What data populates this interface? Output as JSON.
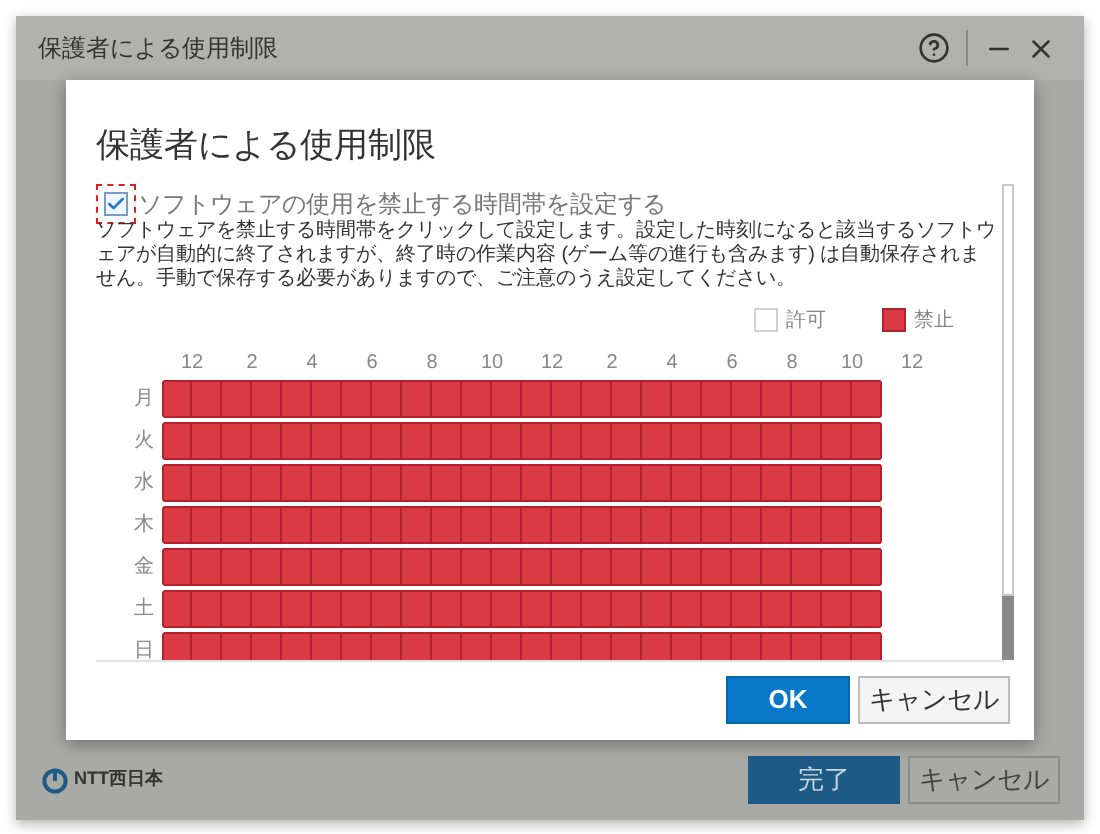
{
  "window": {
    "title": "保護者による使用制限",
    "logo": "NTT西日本",
    "buttons": [
      {
        "label": "完了",
        "kind": "primary"
      },
      {
        "label": "キャンセル",
        "kind": "secondary"
      }
    ]
  },
  "dialog": {
    "title": "保護者による使用制限",
    "checkbox": {
      "label": "ソフトウェアの使用を禁止する時間帯を設定する",
      "checked": true,
      "focused": true
    },
    "description": "ソフトウェアを禁止する時間帯をクリックして設定します。設定した時刻になると該当するソフトウェアが自動的に終了されますが、終了時の作業内容 (ゲーム等の進行も含みます) は自動保存されません。手動で保存する必要がありますので、ご注意のうえ設定してください。",
    "legend": [
      {
        "label": "許可",
        "kind": "allow"
      },
      {
        "label": "禁止",
        "kind": "block"
      }
    ],
    "schedule": {
      "hours": [
        "12",
        "2",
        "4",
        "6",
        "8",
        "10",
        "12",
        "2",
        "4",
        "6",
        "8",
        "10",
        "12"
      ],
      "rows": [
        {
          "day": "月",
          "blocked": [
            true,
            true,
            true,
            true,
            true,
            true,
            true,
            true,
            true,
            true,
            true,
            true,
            true,
            true,
            true,
            true,
            true,
            true,
            true,
            true,
            true,
            true,
            true,
            true
          ]
        },
        {
          "day": "火",
          "blocked": [
            true,
            true,
            true,
            true,
            true,
            true,
            true,
            true,
            true,
            true,
            true,
            true,
            true,
            true,
            true,
            true,
            true,
            true,
            true,
            true,
            true,
            true,
            true,
            true
          ]
        },
        {
          "day": "水",
          "blocked": [
            true,
            true,
            true,
            true,
            true,
            true,
            true,
            true,
            true,
            true,
            true,
            true,
            true,
            true,
            true,
            true,
            true,
            true,
            true,
            true,
            true,
            true,
            true,
            true
          ]
        },
        {
          "day": "木",
          "blocked": [
            true,
            true,
            true,
            true,
            true,
            true,
            true,
            true,
            true,
            true,
            true,
            true,
            true,
            true,
            true,
            true,
            true,
            true,
            true,
            true,
            true,
            true,
            true,
            true
          ]
        },
        {
          "day": "金",
          "blocked": [
            true,
            true,
            true,
            true,
            true,
            true,
            true,
            true,
            true,
            true,
            true,
            true,
            true,
            true,
            true,
            true,
            true,
            true,
            true,
            true,
            true,
            true,
            true,
            true
          ]
        },
        {
          "day": "土",
          "blocked": [
            true,
            true,
            true,
            true,
            true,
            true,
            true,
            true,
            true,
            true,
            true,
            true,
            true,
            true,
            true,
            true,
            true,
            true,
            true,
            true,
            true,
            true,
            true,
            true
          ]
        },
        {
          "day": "日",
          "blocked": [
            true,
            true,
            true,
            true,
            true,
            true,
            true,
            true,
            true,
            true,
            true,
            true,
            true,
            true,
            true,
            true,
            true,
            true,
            true,
            true,
            true,
            true,
            true,
            true
          ]
        }
      ]
    },
    "buttons": [
      {
        "label": "OK",
        "kind": "primary"
      },
      {
        "label": "キャンセル",
        "kind": "secondary"
      }
    ]
  }
}
